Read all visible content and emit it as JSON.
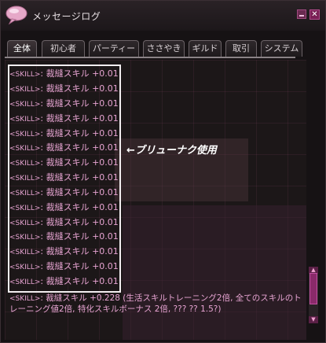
{
  "window": {
    "title": "メッセージログ",
    "minimize_symbol": "_",
    "close_symbol": "✕"
  },
  "tabs": [
    {
      "label": "全体",
      "active": true
    },
    {
      "label": "初心者",
      "active": false
    },
    {
      "label": "パーティー",
      "active": false
    },
    {
      "label": "ささやき",
      "active": false
    },
    {
      "label": "ギルド",
      "active": false
    },
    {
      "label": "取引",
      "active": false
    },
    {
      "label": "システム",
      "active": false
    }
  ],
  "log": {
    "entries": [
      {
        "tag": "<SKILL>",
        "text": ": 裁縫スキル +0.01"
      },
      {
        "tag": "<SKILL>",
        "text": ": 裁縫スキル +0.01"
      },
      {
        "tag": "<SKILL>",
        "text": ": 裁縫スキル +0.01"
      },
      {
        "tag": "<SKILL>",
        "text": ": 裁縫スキル +0.01"
      },
      {
        "tag": "<SKILL>",
        "text": ": 裁縫スキル +0.01"
      },
      {
        "tag": "<SKILL>",
        "text": ": 裁縫スキル +0.01"
      },
      {
        "tag": "<SKILL>",
        "text": ": 裁縫スキル +0.01"
      },
      {
        "tag": "<SKILL>",
        "text": ": 裁縫スキル +0.01"
      },
      {
        "tag": "<SKILL>",
        "text": ": 裁縫スキル +0.01"
      },
      {
        "tag": "<SKILL>",
        "text": ": 裁縫スキル +0.01"
      },
      {
        "tag": "<SKILL>",
        "text": ": 裁縫スキル +0.01"
      },
      {
        "tag": "<SKILL>",
        "text": ": 裁縫スキル +0.01"
      },
      {
        "tag": "<SKILL>",
        "text": ": 裁縫スキル +0.01"
      },
      {
        "tag": "<SKILL>",
        "text": ": 裁縫スキル +0.01"
      },
      {
        "tag": "<SKILL>",
        "text": ": 裁縫スキル +0.01"
      }
    ],
    "last_entry": {
      "tag": "<SKILL>",
      "text": ": 裁縫スキル +0.228 (生活スキルトレーニング2倍, 全てのスキルのトレーニング値2倍, 特化スキルボーナス 2倍, ??? ?? 1.5?)"
    }
  },
  "annotation": "←ブリューナク使用",
  "scrollbar": {
    "up_symbol": "▲",
    "down_symbol": "▼"
  },
  "colors": {
    "log_text": "#e7a4d2",
    "window_bg": "#161214",
    "accent": "#8a2a6a"
  },
  "icons": {
    "title_icon": "speech-bubble-icon"
  }
}
